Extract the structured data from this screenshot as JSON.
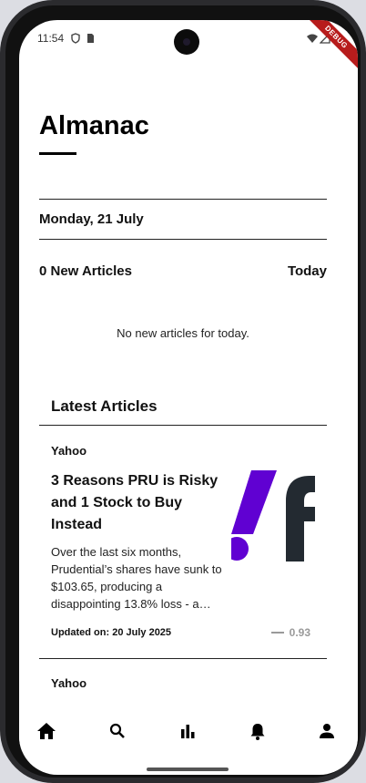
{
  "status_bar": {
    "time": "11:54",
    "debug_label": "DEBUG"
  },
  "header": {
    "title": "Almanac",
    "date": "Monday, 21 July"
  },
  "today_section": {
    "count_label": "0 New Articles",
    "period_label": "Today",
    "empty_message": "No new articles for today."
  },
  "latest": {
    "heading": "Latest Articles",
    "articles": [
      {
        "source": "Yahoo",
        "title": "3 Reasons PRU is Risky and 1 Stock to Buy Instead",
        "summary": "Over the last six months, Prudential’s shares have sunk to $103.65, producing a disappointing 13.8% loss - a…",
        "updated": "Updated on: 20 July 2025",
        "score": "0.93",
        "thumbnail_icon": "yahoo-finance-logo"
      },
      {
        "source": "Yahoo"
      }
    ]
  },
  "bottom_nav": {
    "items": [
      "home-icon",
      "search-icon",
      "chart-icon",
      "bell-icon",
      "person-icon"
    ],
    "active": "home-icon"
  },
  "colors": {
    "accent_purple": "#6001d2",
    "logo_dark": "#232a31",
    "debug_red": "#b71c1c"
  }
}
